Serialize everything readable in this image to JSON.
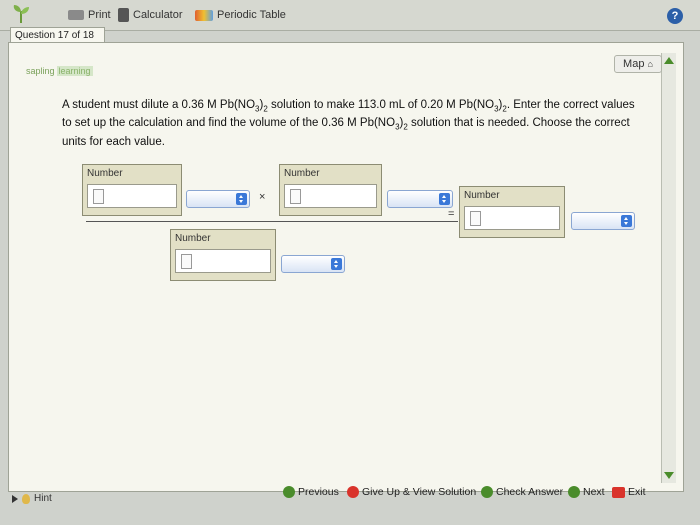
{
  "toolbar": {
    "print_label": "Print",
    "calculator_label": "Calculator",
    "periodic_table_label": "Periodic Table",
    "help_label": "?"
  },
  "question_tab": {
    "label": "Question 17 of 18"
  },
  "map_label": "Map",
  "brand": {
    "part1": "sapling",
    "part2": "learning"
  },
  "question": {
    "t1": "A student must dilute a 0.36 M Pb(NO",
    "s1": "3",
    "t2": ")",
    "s2": "2",
    "t3": " solution to make 113.0 mL of 0.20 M Pb(NO",
    "s3": "3",
    "t4": ")",
    "s4": "2",
    "t5": ". Enter the correct values to set up the calculation and find the volume of the 0.36 M Pb(NO",
    "s5": "3",
    "t6": ")",
    "s6": "2",
    "t7": " solution that is needed. Choose the correct units for each value."
  },
  "equation": {
    "box_label": "Number",
    "times": "×",
    "equals": "="
  },
  "nav": {
    "previous": "Previous",
    "give_up": "Give Up & View Solution",
    "check_answer": "Check Answer",
    "next": "Next",
    "exit": "Exit"
  },
  "hint_label": "Hint",
  "colors": {
    "brand_green": "#4a8c2b",
    "select_blue": "#3a78d8",
    "help_blue": "#2c5fa8"
  }
}
